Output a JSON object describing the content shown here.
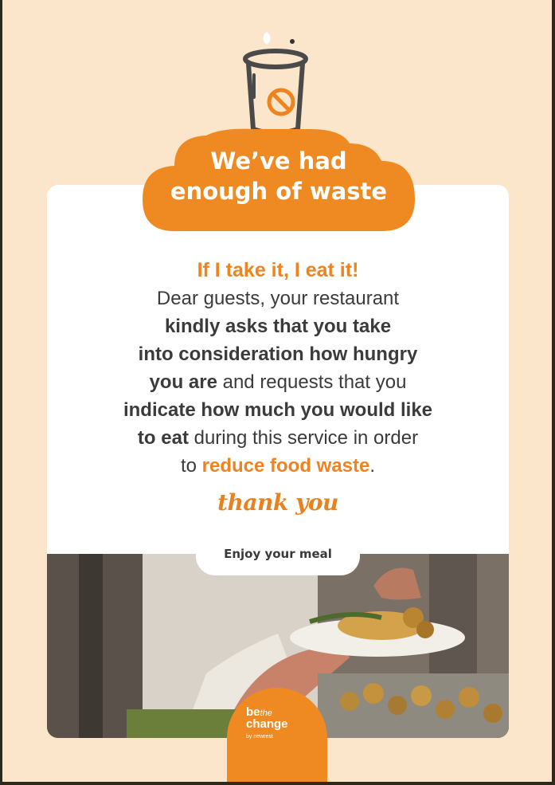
{
  "title": {
    "line1": "We’ve had",
    "line2": "enough of waste"
  },
  "message": {
    "headline": "If I take it, I eat it!",
    "l2": "Dear guests, your restaurant",
    "l3": "kindly asks that you take",
    "l4": "into consideration how hungry",
    "l5a": "you are",
    "l5b": " and requests that you",
    "l6": "indicate how much you would like",
    "l7a": "to eat",
    "l7b": " during this service in order",
    "l8a": "to ",
    "l8b": "reduce food waste",
    "l8c": "."
  },
  "thanks": "thank you",
  "enjoy": "Enjoy your meal",
  "badge": {
    "line1": "be",
    "line1b": "the",
    "line2": "change",
    "line3": "by newrest"
  },
  "icons": {
    "top": "no-can-icon",
    "photo": "buffet-serving-photo"
  },
  "colors": {
    "accent": "#ef8a22",
    "background": "#fbe5cb",
    "text": "#3b3b3b"
  }
}
